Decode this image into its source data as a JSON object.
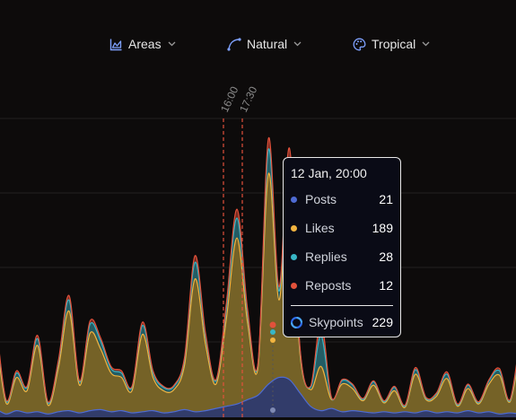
{
  "toolbar": {
    "chart_type": {
      "label": "Areas",
      "icon": "area-chart-icon"
    },
    "curve": {
      "label": "Natural",
      "icon": "curve-icon"
    },
    "palette": {
      "label": "Tropical",
      "icon": "palette-icon"
    }
  },
  "colors": {
    "posts": "#4e6bd3",
    "likes": "#f2b440",
    "replies": "#38b6c6",
    "reposts": "#e2513b",
    "background": "#0d0b0b"
  },
  "markers": [
    "16:00",
    "17:30"
  ],
  "tooltip": {
    "title": "12 Jan, 20:00",
    "rows": [
      {
        "label": "Posts",
        "value": "21"
      },
      {
        "label": "Likes",
        "value": "189"
      },
      {
        "label": "Replies",
        "value": "28"
      },
      {
        "label": "Reposts",
        "value": "12"
      }
    ],
    "total": {
      "label": "Skypoints",
      "value": "229",
      "icon": "skypoints-icon"
    }
  },
  "chart_data": {
    "type": "area",
    "stacked": true,
    "curve": "natural",
    "series": [
      {
        "name": "Posts",
        "values": [
          8,
          3,
          6,
          4,
          5,
          3,
          5,
          6,
          4,
          6,
          7,
          5,
          6,
          4,
          5,
          6,
          4,
          5,
          7,
          5,
          6,
          8,
          10,
          12,
          16,
          20,
          30,
          36,
          34,
          22,
          10,
          6,
          8,
          5,
          6,
          5,
          4,
          5,
          4,
          5,
          4,
          6,
          4,
          5,
          4,
          6,
          4,
          5,
          3,
          4,
          3
        ]
      },
      {
        "name": "Likes",
        "values": [
          70,
          10,
          30,
          20,
          60,
          8,
          40,
          90,
          25,
          70,
          55,
          35,
          30,
          20,
          70,
          30,
          20,
          20,
          40,
          120,
          60,
          22,
          80,
          150,
          70,
          25,
          190,
          70,
          180,
          35,
          15,
          40,
          8,
          25,
          20,
          10,
          25,
          8,
          20,
          4,
          35,
          10,
          15,
          30,
          6,
          20,
          8,
          25,
          35,
          10,
          60
        ]
      },
      {
        "name": "Replies",
        "values": [
          10,
          2,
          4,
          3,
          6,
          2,
          5,
          10,
          3,
          8,
          7,
          4,
          4,
          3,
          8,
          4,
          3,
          3,
          5,
          15,
          7,
          3,
          10,
          18,
          8,
          3,
          22,
          8,
          20,
          4,
          2,
          28,
          1,
          3,
          3,
          1,
          3,
          1,
          3,
          1,
          4,
          1,
          2,
          4,
          1,
          3,
          1,
          3,
          4,
          1,
          8
        ]
      },
      {
        "name": "Reposts",
        "values": [
          3,
          1,
          2,
          1,
          3,
          1,
          2,
          4,
          1,
          3,
          3,
          2,
          2,
          1,
          3,
          2,
          1,
          1,
          2,
          6,
          3,
          1,
          4,
          8,
          4,
          1,
          10,
          4,
          9,
          2,
          1,
          12,
          1,
          1,
          1,
          1,
          1,
          1,
          1,
          1,
          2,
          1,
          1,
          2,
          1,
          1,
          1,
          1,
          2,
          1,
          4
        ]
      }
    ],
    "xlabel": "",
    "ylabel": "",
    "grid": true,
    "legend": "none"
  }
}
